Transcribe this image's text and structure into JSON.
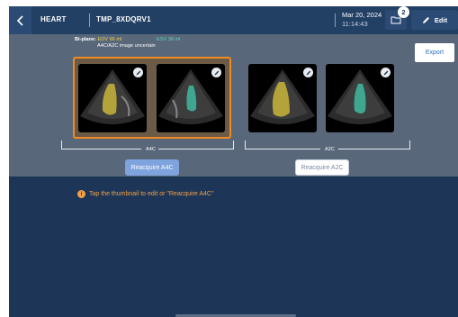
{
  "header": {
    "title": "HEART",
    "patient_id": "TMP_8XDQRV1",
    "date": "Mar 20, 2024",
    "time": "11:14:43",
    "folder_badge": "2",
    "edit_label": "Edit"
  },
  "measurements": {
    "label": "Bi-plane:",
    "edv": "EDV 96 ml",
    "esv": "ESV 38 ml",
    "warning": "A4C/A2C image uncertain"
  },
  "export_label": "Export",
  "views": [
    {
      "label": "A4C",
      "reacquire_label": "Reacquire A4C",
      "selected": true
    },
    {
      "label": "A2C",
      "reacquire_label": "Reacquire A2C",
      "selected": false
    }
  ],
  "tip": "Tap the thumbnail to edit or \"Reacquire A4C\"",
  "colors": {
    "background": "#1d3657",
    "panel": "#59677a",
    "selection": "#f08b22",
    "edv_overlay": "#f2d14b",
    "esv_overlay": "#5ed6c0",
    "primary_button": "#7fa3dc",
    "tip": "#f0a14a"
  },
  "icons": [
    "back-chevron-icon",
    "folder-icon",
    "pencil-icon",
    "info-icon"
  ]
}
